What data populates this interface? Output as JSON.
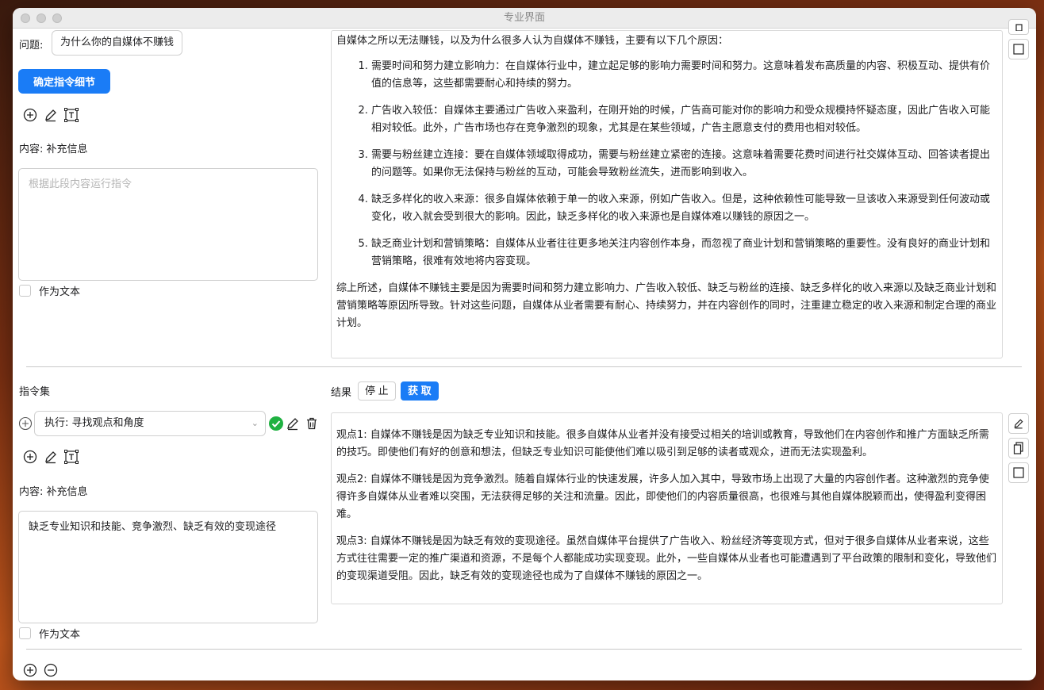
{
  "window": {
    "title": "专业界面"
  },
  "top": {
    "question_label": "问题:",
    "question_value": "为什么你的自媒体不赚钱",
    "confirm_button": "确定指令细节",
    "content_label": "内容: 补充信息",
    "content_placeholder": "根据此段内容运行指令",
    "as_text_label": "作为文本",
    "result": {
      "intro": "自媒体之所以无法赚钱，以及为什么很多人认为自媒体不赚钱，主要有以下几个原因：",
      "items": [
        "需要时间和努力建立影响力：在自媒体行业中，建立起足够的影响力需要时间和努力。这意味着发布高质量的内容、积极互动、提供有价值的信息等，这些都需要耐心和持续的努力。",
        "广告收入较低：自媒体主要通过广告收入来盈利，在刚开始的时候，广告商可能对你的影响力和受众规模持怀疑态度，因此广告收入可能相对较低。此外，广告市场也存在竞争激烈的现象，尤其是在某些领域，广告主愿意支付的费用也相对较低。",
        "需要与粉丝建立连接：要在自媒体领域取得成功，需要与粉丝建立紧密的连接。这意味着需要花费时间进行社交媒体互动、回答读者提出的问题等。如果你无法保持与粉丝的互动，可能会导致粉丝流失，进而影响到收入。",
        "缺乏多样化的收入来源：很多自媒体依赖于单一的收入来源，例如广告收入。但是，这种依赖性可能导致一旦该收入来源受到任何波动或变化，收入就会受到很大的影响。因此，缺乏多样化的收入来源也是自媒体难以赚钱的原因之一。",
        "缺乏商业计划和营销策略：自媒体从业者往往更多地关注内容创作本身，而忽视了商业计划和营销策略的重要性。没有良好的商业计划和营销策略，很难有效地将内容变现。"
      ],
      "summary": "综上所述，自媒体不赚钱主要是因为需要时间和努力建立影响力、广告收入较低、缺乏与粉丝的连接、缺乏多样化的收入来源以及缺乏商业计划和营销策略等原因所导致。针对这些问题，自媒体从业者需要有耐心、持续努力，并在内容创作的同时，注重建立稳定的收入来源和制定合理的商业计划。"
    }
  },
  "bottom": {
    "instruction_set_label": "指令集",
    "result_label": "结果",
    "stop_button": "停 止",
    "fetch_button": "获 取",
    "selected_instruction": "执行: 寻找观点和角度",
    "content_label": "内容: 补充信息",
    "content_value": "缺乏专业知识和技能、竞争激烈、缺乏有效的变现途径",
    "as_text_label": "作为文本",
    "result": {
      "points": [
        "观点1: 自媒体不赚钱是因为缺乏专业知识和技能。很多自媒体从业者并没有接受过相关的培训或教育，导致他们在内容创作和推广方面缺乏所需的技巧。即使他们有好的创意和想法，但缺乏专业知识可能使他们难以吸引到足够的读者或观众，进而无法实现盈利。",
        "观点2: 自媒体不赚钱是因为竞争激烈。随着自媒体行业的快速发展，许多人加入其中，导致市场上出现了大量的内容创作者。这种激烈的竞争使得许多自媒体从业者难以突围，无法获得足够的关注和流量。因此，即使他们的内容质量很高，也很难与其他自媒体脱颖而出，使得盈利变得困难。",
        "观点3: 自媒体不赚钱是因为缺乏有效的变现途径。虽然自媒体平台提供了广告收入、粉丝经济等变现方式，但对于很多自媒体从业者来说，这些方式往往需要一定的推广渠道和资源，不是每个人都能成功实现变现。此外，一些自媒体从业者也可能遭遇到了平台政策的限制和变化，导致他们的变现渠道受阻。因此，缺乏有效的变现途径也成为了自媒体不赚钱的原因之一。"
      ]
    }
  },
  "colors": {
    "accent": "#1a7cf6",
    "success": "#1fb141"
  }
}
